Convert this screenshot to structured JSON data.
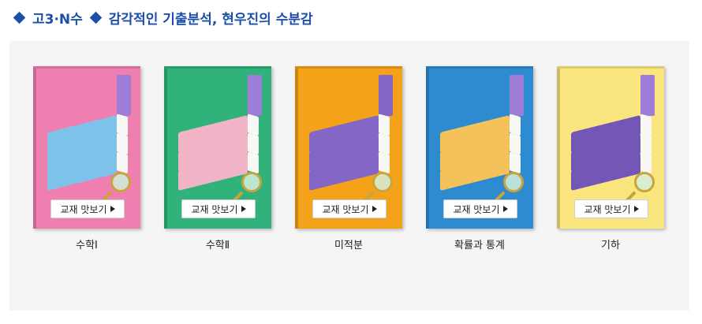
{
  "header": {
    "part1": "고3·N수",
    "part2": "감각적인 기출분석, 현우진의 수분감"
  },
  "books": [
    {
      "label": "수학Ⅰ",
      "button": "교재 맛보기",
      "cover": "#ee7fb0",
      "accent": "#7ec3ea",
      "band": "#9d7dd8"
    },
    {
      "label": "수학Ⅱ",
      "button": "교재 맛보기",
      "cover": "#30b27a",
      "accent": "#f2b5c8",
      "band": "#9d7dd8"
    },
    {
      "label": "미적분",
      "button": "교재 맛보기",
      "cover": "#f4a21a",
      "accent": "#8466c7",
      "band": "#8466c7"
    },
    {
      "label": "확률과 통계",
      "button": "교재 맛보기",
      "cover": "#2e8bd0",
      "accent": "#f5c15a",
      "band": "#9d7dd8"
    },
    {
      "label": "기하",
      "button": "교재 맛보기",
      "cover": "#fbe57e",
      "accent": "#7356b5",
      "band": "#9d7dd8"
    }
  ],
  "colors": {
    "title": "#1d4fa8",
    "panel": "#f5f5f5"
  }
}
